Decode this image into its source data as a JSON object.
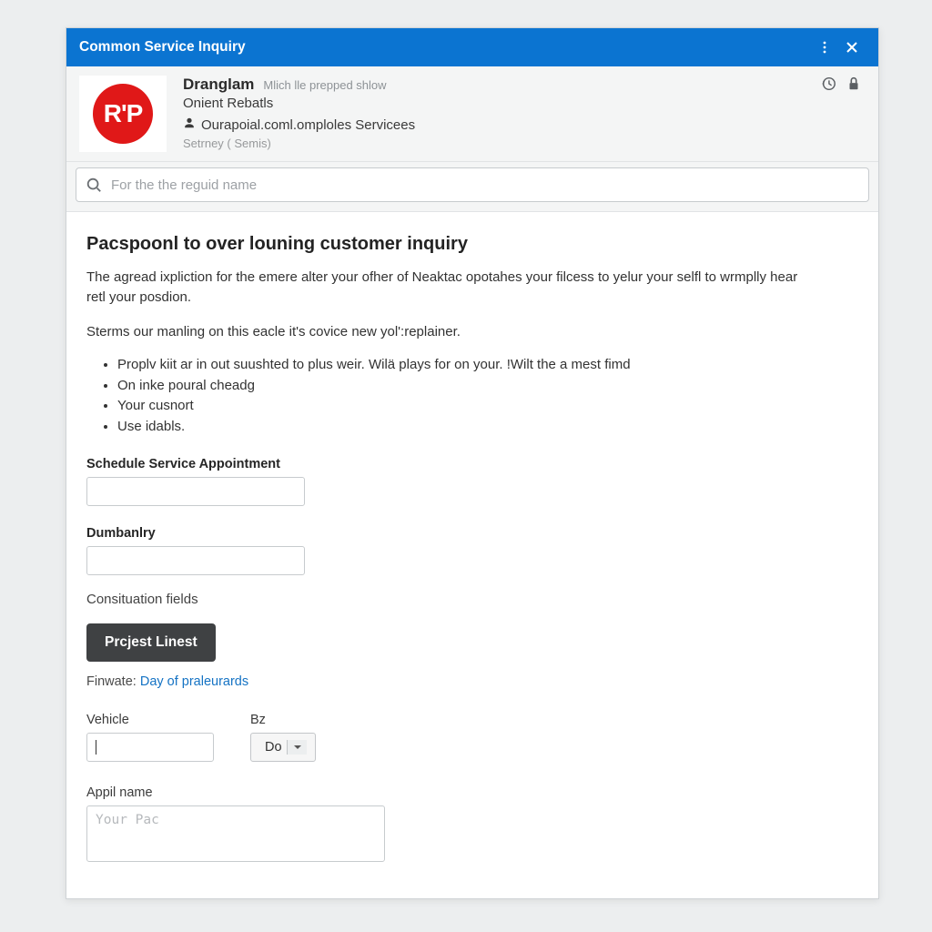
{
  "titlebar": {
    "title": "Common Service  Inquiry"
  },
  "header": {
    "logo_text": "R'P",
    "name": "Dranglam",
    "tagline": "Mlich lle prepped shlow",
    "line2": "Onient Rebatls",
    "line3": "Ourapoial.coml.omploles Servicees",
    "line4": "Setrney ( Semis)"
  },
  "search": {
    "placeholder": "For the the reguid name"
  },
  "form": {
    "title": "Pacspoonl to over louning customer inquiry",
    "para1": "The agread ixpliction for the emere alter your ofher of Neaktac opotahes your filcess to yelur your selfl to wrmplly hear retl your posdion.",
    "para2": "Sterms our manling on this eacle it's covice new yol':replainer.",
    "bullets": [
      "Proplv kiit ar in out suushted to plus weir. Wilä plays for on your. !Wilt the a mest fimd",
      "On inke poural cheadg",
      "Your cusnort",
      "Use idabls."
    ],
    "schedule_label": "Schedule Service Appointment",
    "schedule_value": "",
    "dumbanlry_label": "Dumbanlry",
    "dumbanlry_value": "",
    "consituation_label": "Consituation fields",
    "button_label": "Prcjest Linest",
    "finwate_label": "Finwate:",
    "finwate_link": "Day of praleurards",
    "vehicle_label": "Vehicle",
    "vehicle_value": "",
    "bz_label": "Bz",
    "bz_value": "Do",
    "appil_label": "Appil name",
    "appil_placeholder": "Your Pac"
  }
}
